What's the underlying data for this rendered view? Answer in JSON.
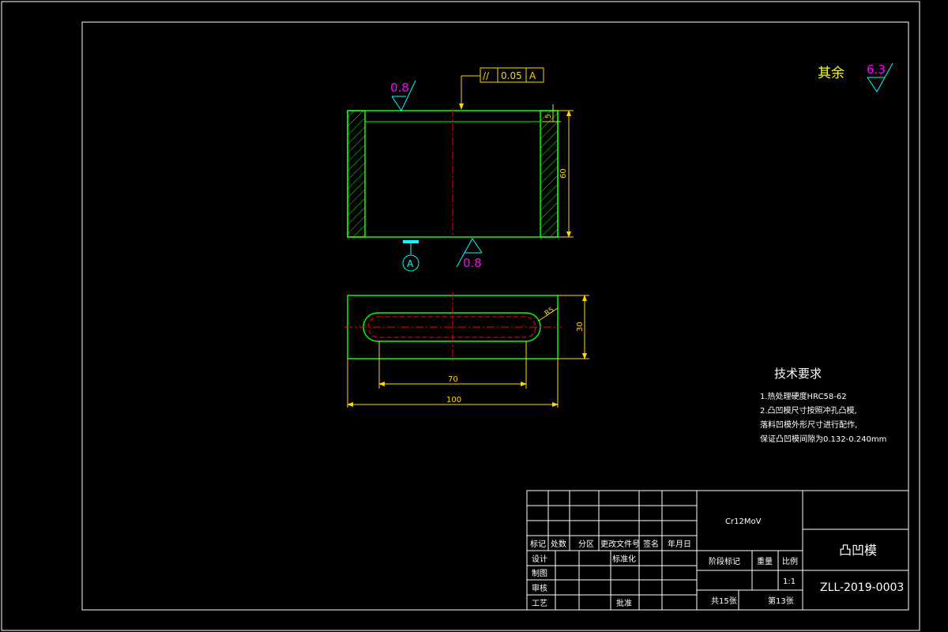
{
  "colors": {
    "background": "#000000",
    "frame": "#ffffff",
    "outline": "#00ff00",
    "centerline": "#ff0000",
    "dimension": "#ffd700",
    "roughness": "#ff00ff",
    "datum": "#00ffff"
  },
  "front_view": {
    "roughness_top": "0.8",
    "roughness_bottom": "0.8",
    "tolerance_symbol": "//",
    "tolerance_value": "0.05",
    "tolerance_datum": "A",
    "datum_label": "A",
    "dim_height": "60",
    "dim_top": "5"
  },
  "top_view": {
    "dim_radius": "R5",
    "dim_width": "30",
    "dim_slot": "70",
    "dim_length": "100"
  },
  "general_roughness": {
    "label": "其余",
    "value": "6.3"
  },
  "tech_requirements": {
    "title": "技术要求",
    "lines": [
      "1.热处理硬度HRC58-62",
      "2.凸凹模尺寸按照冲孔凸模,",
      "落料凹模外形尺寸进行配作,",
      "保证凸凹模间隙为0.132-0.240mm"
    ]
  },
  "title_block": {
    "material": "Cr12MoV",
    "part_name": "凸凹模",
    "drawing_no": "ZLL-2019-0003",
    "header_row": [
      "标记",
      "处数",
      "分区",
      "更改文件号",
      "签名",
      "年月日"
    ],
    "design": "设计",
    "standardize": "标准化",
    "draw": "制图",
    "review": "审核",
    "process": "工艺",
    "approve": "批准",
    "stage_mark": "阶段标记",
    "weight": "重量",
    "scale": "比例",
    "scale_value": "1:1",
    "total_sheets": "共15张",
    "sheet_no": "第13张"
  }
}
